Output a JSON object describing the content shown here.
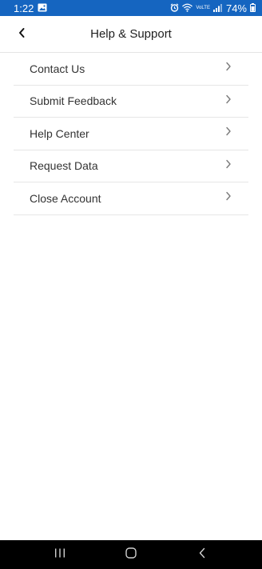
{
  "status_bar": {
    "time": "1:22",
    "battery": "74%",
    "network_label": "VoLTE"
  },
  "header": {
    "title": "Help & Support"
  },
  "menu": {
    "items": [
      {
        "label": "Contact Us"
      },
      {
        "label": "Submit Feedback"
      },
      {
        "label": "Help Center"
      },
      {
        "label": "Request Data"
      },
      {
        "label": "Close Account"
      }
    ]
  },
  "colors": {
    "status_bar_bg": "#1565c0",
    "nav_bar_bg": "#000000"
  }
}
